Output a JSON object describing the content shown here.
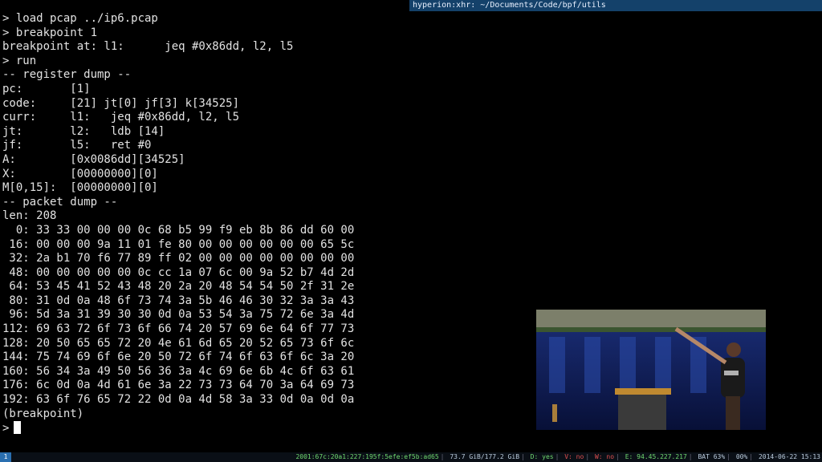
{
  "window": {
    "title": "hyperion:xhr: ~/Documents/Code/bpf/utils"
  },
  "terminal": {
    "lines": [
      "> load pcap ../ip6.pcap",
      "> breakpoint 1",
      "breakpoint at: l1:      jeq #0x86dd, l2, l5",
      "> run",
      "-- register dump --",
      "pc:       [1]",
      "code:     [21] jt[0] jf[3] k[34525]",
      "curr:     l1:   jeq #0x86dd, l2, l5",
      "jt:       l2:   ldb [14]",
      "jf:       l5:   ret #0",
      "A:        [0x0086dd][34525]",
      "X:        [00000000][0]",
      "M[0,15]:  [00000000][0]",
      "-- packet dump --",
      "len: 208",
      "  0: 33 33 00 00 00 0c 68 b5 99 f9 eb 8b 86 dd 60 00",
      " 16: 00 00 00 9a 11 01 fe 80 00 00 00 00 00 00 65 5c",
      " 32: 2a b1 70 f6 77 89 ff 02 00 00 00 00 00 00 00 00",
      " 48: 00 00 00 00 00 0c cc 1a 07 6c 00 9a 52 b7 4d 2d",
      " 64: 53 45 41 52 43 48 20 2a 20 48 54 54 50 2f 31 2e",
      " 80: 31 0d 0a 48 6f 73 74 3a 5b 46 46 30 32 3a 3a 43",
      " 96: 5d 3a 31 39 30 30 0d 0a 53 54 3a 75 72 6e 3a 4d",
      "112: 69 63 72 6f 73 6f 66 74 20 57 69 6e 64 6f 77 73",
      "128: 20 50 65 65 72 20 4e 61 6d 65 20 52 65 73 6f 6c",
      "144: 75 74 69 6f 6e 20 50 72 6f 74 6f 63 6f 6c 3a 20",
      "160: 56 34 3a 49 50 56 36 3a 4c 69 6e 6b 4c 6f 63 61",
      "176: 6c 0d 0a 4d 61 6e 3a 22 73 73 64 70 3a 64 69 73",
      "192: 63 6f 76 65 72 22 0d 0a 4d 58 3a 33 0d 0a 0d 0a",
      "(breakpoint)"
    ],
    "prompt": ">"
  },
  "statusbar": {
    "workspace": "1",
    "ipv6": "2001:67c:20a1:227:195f:5efe:ef5b:ad65",
    "disk": "73.7 GiB/177.2 GiB",
    "d": "D: yes",
    "v": "V: no",
    "w": "W: no",
    "e": "E: 94.45.227.217",
    "bat": "BAT 63%",
    "pct": "00%",
    "datetime": "2014-06-22 15:13"
  },
  "colors": {
    "title_bg": "#14416a",
    "status_green": "#6fd86f",
    "status_red": "#e05050"
  }
}
